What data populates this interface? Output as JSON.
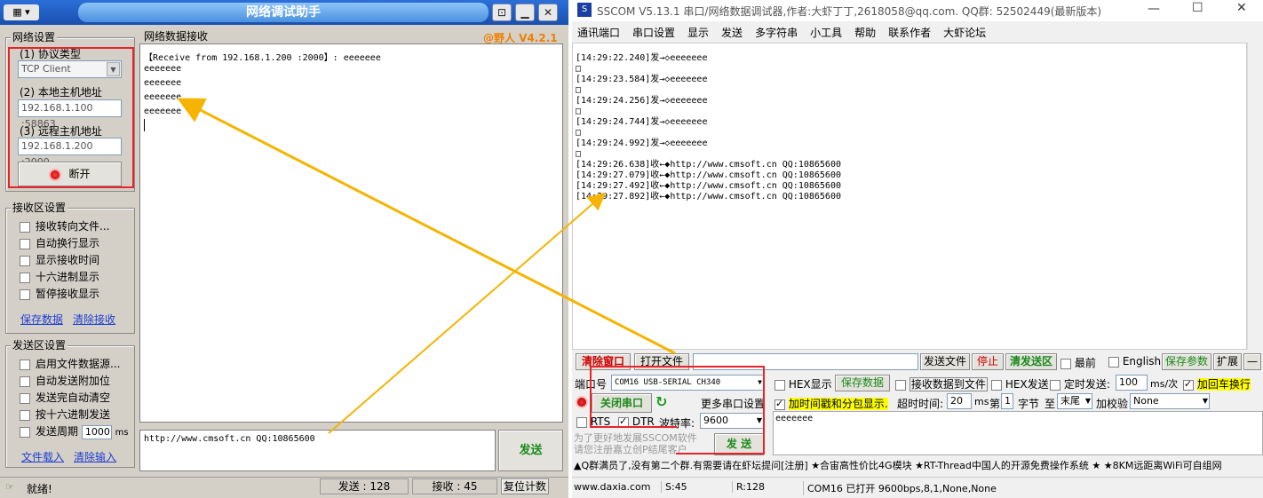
{
  "left_app": {
    "title": "网络调试助手",
    "brand": "@野人 V4.2.1",
    "net_settings": {
      "legend": "网络设置",
      "protocol_label": "(1) 协议类型",
      "protocol_value": "TCP Client",
      "local_label": "(2) 本地主机地址",
      "local_value": "192.168.1.100 :58863",
      "remote_label": "(3) 远程主机地址",
      "remote_value": "192.168.1.200 :2000",
      "disconnect_label": "断开"
    },
    "recv_settings": {
      "legend": "接收区设置",
      "options": [
        "接收转向文件...",
        "自动换行显示",
        "显示接收时间",
        "十六进制显示",
        "暂停接收显示"
      ],
      "save_link": "保存数据",
      "clear_link": "清除接收"
    },
    "send_settings": {
      "legend": "发送区设置",
      "options": [
        "启用文件数据源...",
        "自动发送附加位",
        "发送完自动清空",
        "按十六进制发送"
      ],
      "period_label": "发送周期",
      "period_value": "1000",
      "period_unit": "ms",
      "load_link": "文件载入",
      "clear_link": "清除输入"
    },
    "recv_area": {
      "legend": "网络数据接收",
      "header": "【Receive from 192.168.1.200 :2000】: eeeeeee",
      "lines": [
        "eeeeeee",
        "eeeeeee",
        "eeeeeee",
        "eeeeeee"
      ]
    },
    "send_input": "http://www.cmsoft.cn QQ:10865600",
    "send_button": "发送",
    "status": {
      "ready": "就绪!",
      "sent_label": "发送 : 128",
      "recv_label": "接收 : 45",
      "reset": "复位计数"
    }
  },
  "right_app": {
    "title": "SSCOM V5.13.1 串口/网络数据调试器,作者:大虾丁丁,2618058@qq.com. QQ群: 52502449(最新版本)",
    "menu": [
      "通讯端口",
      "串口设置",
      "显示",
      "发送",
      "多字符串",
      "小工具",
      "帮助",
      "联系作者",
      "大虾论坛"
    ],
    "log": [
      {
        "t": "[14:29:22.240]发→◇eeeeeee"
      },
      {
        "t": "□"
      },
      {
        "t": "[14:29:23.584]发→◇eeeeeee"
      },
      {
        "t": "□"
      },
      {
        "t": "[14:29:24.256]发→◇eeeeeee"
      },
      {
        "t": "□"
      },
      {
        "t": "[14:29:24.744]发→◇eeeeeee"
      },
      {
        "t": "□"
      },
      {
        "t": "[14:29:24.992]发→◇eeeeeee"
      },
      {
        "t": "□"
      },
      {
        "t": "[14:29:26.638]收←◆http://www.cmsoft.cn QQ:10865600"
      },
      {
        "t": "[14:29:27.079]收←◆http://www.cmsoft.cn QQ:10865600"
      },
      {
        "t": "[14:29:27.492]收←◆http://www.cmsoft.cn QQ:10865600"
      },
      {
        "t": "[14:29:27.892]收←◆http://www.cmsoft.cn QQ:10865600"
      }
    ],
    "toolbar": {
      "clear_window": "清除窗口",
      "open_file": "打开文件",
      "send_file": "发送文件",
      "stop": "停止",
      "clear_send": "清发送区",
      "topmost": "最前",
      "english": "English",
      "save_params": "保存参数",
      "expand": "扩展",
      "minus": "—"
    },
    "port": {
      "port_label": "端口号",
      "port_value": "COM16 USB-SERIAL CH340",
      "close_port": "关闭串口",
      "more_settings": "更多串口设置",
      "rts": "RTS",
      "dtr": "DTR",
      "baud_label": "波特率:",
      "baud_value": "9600",
      "promo1": "为了更好地发展SSCOM软件",
      "promo2": "请您注册嘉立创P结尾客户",
      "send": "发 送"
    },
    "opts": {
      "hex_display": "HEX显示",
      "save_data": "保存数据",
      "recv_to_file": "接收数据到文件",
      "hex_send": "HEX发送",
      "timed_send": "定时发送:",
      "timed_value": "100",
      "timed_unit": "ms/次",
      "add_crlf": "加回车换行",
      "add_timestamp": "加时间戳和分包显示.",
      "timeout_label": "超时时间:",
      "timeout_value": "20",
      "timeout_unit": "ms",
      "nth": "第",
      "nth_value": "1",
      "byte": "字节",
      "to": "至",
      "end": "末尾",
      "checksum": "加校验",
      "checksum_value": "None"
    },
    "send_text": "eeeeeee",
    "ticker": "▲Q群满员了,没有第二个群.有需要请在虾坛提问[注册] ★合宙高性价比4G模块 ★RT-Thread中国人的开源免费操作系统 ★ ★8KM远距离WiFi可自组网",
    "status": {
      "site": "www.daxia.com",
      "s": "S:45",
      "r": "R:128",
      "port_status": "COM16 已打开  9600bps,8,1,None,None"
    }
  },
  "colors": {
    "annotation_red": "#e8232a",
    "arrow_orange": "#f5b400"
  }
}
